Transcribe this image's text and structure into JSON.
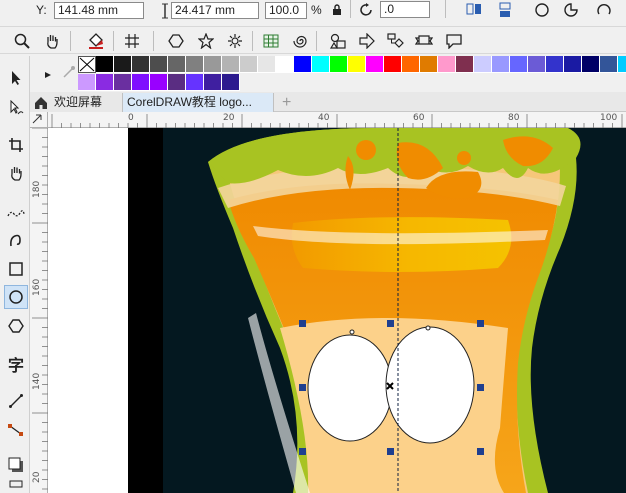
{
  "property_bar": {
    "y_label": "Y:",
    "y_value": "141.48 mm",
    "height_value": "24.417 mm",
    "scale_value": "100.0",
    "percent": "%",
    "rotation_value": ".0"
  },
  "toolbar": {
    "icons": [
      "zoom-icon",
      "pan-hand-icon",
      "fill-bucket-icon",
      "grid-snap-icon",
      "hexagon-icon",
      "star-icon",
      "complex-star-icon",
      "table-grid-icon",
      "spiral-icon",
      "basic-shapes-icon",
      "arrow-shape-icon",
      "flowchart-icon",
      "banner-icon",
      "callout-icon"
    ]
  },
  "toolbox": {
    "icons": [
      "pick-tool-icon",
      "shape-tool-icon",
      "crop-tool-icon",
      "pan-tool-icon",
      "freehand-tool-icon",
      "smart-draw-icon",
      "rectangle-tool-icon",
      "ellipse-tool-icon",
      "polygon-tool-icon",
      "text-tool-icon",
      "parallel-dimension-icon",
      "connector-tool-icon",
      "drop-shadow-icon"
    ],
    "text_tool_glyph": "字"
  },
  "palette": {
    "row1": [
      "#ffffff",
      "#000000",
      "#1a1a1a",
      "#333333",
      "#4d4d4d",
      "#666666",
      "#808080",
      "#999999",
      "#b3b3b3",
      "#cccccc",
      "#e6e6e6",
      "#ffffff",
      "#0000ff",
      "#00ffff",
      "#00ff00",
      "#ffff00",
      "#ff00ff",
      "#ff0000",
      "#ff6600",
      "#e07b00",
      "#ff99cc",
      "#7f2f4f",
      "#ccccff",
      "#9999ff",
      "#6666ff",
      "#6b5bd6",
      "#3333cc",
      "#1a1aa3",
      "#000066",
      "#335599",
      "#00ccff",
      "#33ddff"
    ],
    "row2": [
      "#cc99ff",
      "#8a2be2",
      "#6a2fa0",
      "#7f0fff",
      "#9900ff",
      "#5a2d82",
      "#6633ff",
      "#3f1fa0",
      "#2d1b8f"
    ]
  },
  "tabs": {
    "welcome": "欢迎屏幕",
    "document": "CorelDRAW教程 logo...",
    "add": "+"
  },
  "rulers": {
    "h_ticks": [
      "0",
      "20",
      "40",
      "60",
      "80",
      "100"
    ],
    "v_ticks": [
      "180",
      "160",
      "140",
      "20"
    ]
  },
  "colors": {
    "dark_bg": "#041820",
    "glass_green": "#a8c322",
    "orange": "#f08c00",
    "light_orange": "#fcd18a",
    "selection_handle": "#1f3f8f"
  }
}
